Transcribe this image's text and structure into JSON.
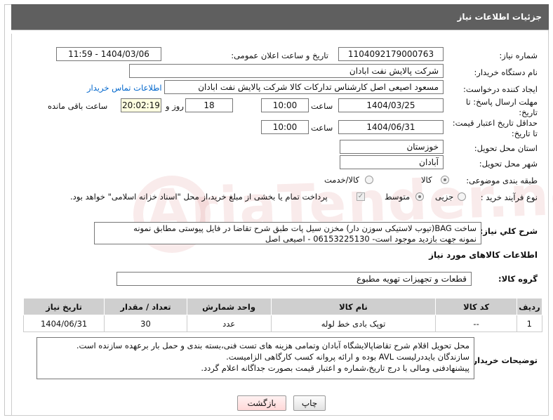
{
  "header": {
    "title": "جزئیات اطلاعات نیاز"
  },
  "form": {
    "need_number_label": "شماره نیاز:",
    "need_number": "1104092179000763",
    "announce_label": "تاریخ و ساعت اعلان عمومی:",
    "announce_value": "1404/03/06 - 11:59",
    "buyer_label": "نام دستگاه خریدار:",
    "buyer_value": "شرکت پالایش نفت ابادان",
    "creator_label": "ایجاد کننده درخواست:",
    "creator_value": "مسعود اصیعی اصل کارشناس تدارکات کالا  شرکت پالایش نفت ابادان",
    "contact_link": "اطلاعات تماس خریدار",
    "deadline_label": "مهلت ارسال پاسخ: تا تاریخ:",
    "deadline_date": "1404/03/25",
    "time_label": "ساعت",
    "deadline_time": "10:00",
    "days_value": "18",
    "days_label": "روز و",
    "remaining_time": "20:02:19",
    "remaining_label": "ساعت باقی مانده",
    "validity_label": "حداقل تاریخ اعتبار قیمت: تا تاریخ:",
    "validity_date": "1404/06/31",
    "validity_time": "10:00",
    "province_label": "استان محل تحویل:",
    "province_value": "خوزستان",
    "city_label": "شهر محل تحویل:",
    "city_value": "آبادان",
    "category_label": "طبقه بندی موضوعی:",
    "category_options": [
      "کالا",
      "کالا/خدمت"
    ],
    "category_selected": "کالا",
    "process_label": "نوع فرآیند خرید :",
    "process_options": [
      "جزیی",
      "متوسط"
    ],
    "process_selected": "متوسط",
    "payment_note": "پرداخت تمام یا بخشی از مبلغ خرید،از محل \"اسناد خزانه اسلامی\" خواهد بود.",
    "description_label": "شرح کلي نياز:",
    "description_line1": "ساخت BAG(تیوب لاستیکی سوزن دار) مخزن سیل پات طبق شرح تقاضا در فایل پیوستی مطابق نمونه",
    "description_line2": "نمونه جهت بازدید موجود است- 06153225130 - اصیعی اصل"
  },
  "goods": {
    "section_title": "اطلاعات کالاهای مورد نیاز",
    "group_label": "گروه کالا:",
    "group_value": "قطعات و تجهیزات تهویه مطبوع",
    "columns": [
      "ردیف",
      "کد کالا",
      "نام کالا",
      "واحد شمارش",
      "تعداد / مقدار",
      "تاریخ نیاز"
    ],
    "rows": [
      [
        "1",
        "--",
        "توپک بادی خط لوله",
        "عدد",
        "30",
        "1404/06/31"
      ]
    ]
  },
  "notes": {
    "label": "توضیحات خریدار:",
    "line1": "محل تحویل اقلام شرح تقاضاپالایشگاه آبادان وتمامی هزینه های تست فنی،بسته بندی و حمل بار برعهده سازنده است.",
    "line2": "سازندگان بایددرلیست AVL بوده و ارائه پروانه کسب کارگاهی الزامیست.",
    "line3": "پیشنهادفنی ومالی با درج تاریخ،شماره و اعتبار قیمت بصورت جداگانه اعلام گردد."
  },
  "buttons": {
    "print": "چاپ",
    "back": "بازگشت"
  }
}
